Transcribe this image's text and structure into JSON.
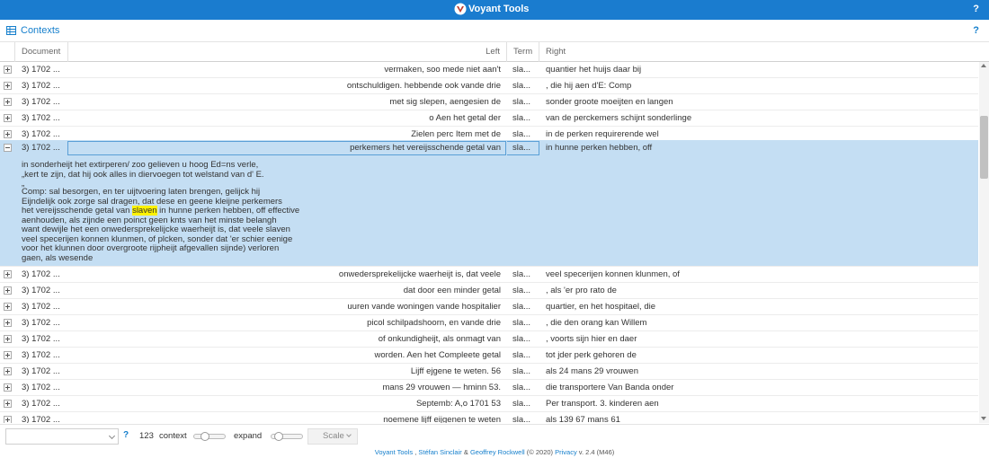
{
  "app": {
    "title": "Voyant Tools",
    "help": "?"
  },
  "panel": {
    "title": "Contexts",
    "help": "?"
  },
  "columns": {
    "document": "Document",
    "left": "Left",
    "term": "Term",
    "right": "Right"
  },
  "rows_before": [
    {
      "doc": "3) 1702 ...",
      "left": "vermaken, soo mede niet aan't",
      "term": "sla...",
      "right": "quantier het huijs daar bij"
    },
    {
      "doc": "3) 1702 ...",
      "left": "ontschuldigen. hebbende ook vande drie",
      "term": "sla...",
      "right": ", die hij aen d'E: Comp"
    },
    {
      "doc": "3) 1702 ...",
      "left": "met sig slepen, aengesien de",
      "term": "sla...",
      "right": "sonder groote moeijten en langen"
    },
    {
      "doc": "3) 1702 ...",
      "left": "o Aen het getal der",
      "term": "sla...",
      "right": "van de perckemers schijnt sonderlinge"
    },
    {
      "doc": "3) 1702 ...",
      "left": "Zielen perc Item met de",
      "term": "sla...",
      "right": "in de perken requirerende wel"
    }
  ],
  "selected_row": {
    "doc": "3) 1702 ...",
    "left": "perkemers het vereijsschende getal van",
    "term": "sla...",
    "right": "in hunne perken hebben, off"
  },
  "expanded": {
    "para1": "in sonderheijt het extirperen/ zoo gelieven u hoog Ed=ns verle,\n„kert te zijn, dat hij ook alles in diervoegen tot welstand van d' E.",
    "para2_top": "„",
    "para2_a": "Comp: sal besorgen, en ter uijtvoering laten brengen, gelijck hij\nEijndelijk ook zorge sal dragen, dat dese en geene kleijne perkemers\nhet vereijsschende getal van ",
    "keyword": "slaven",
    "para2_b": " in hunne perken hebben, off effective\naenhouden, als zijnde een poinct geen knts van het minste belangh\nwant dewijle het een onwedersprekelijcke waerheijt is, dat veele slaven\nveel specerijen konnen klunmen, of plcken, sonder dat 'er schier eenige\nvoor het klunnen door overgroote rijpheijt afgevallen sijnde) verloren\ngaen, als wesende"
  },
  "rows_after": [
    {
      "doc": "3) 1702 ...",
      "left": "onwedersprekelijcke waerheijt is, dat veele",
      "term": "sla...",
      "right": "veel specerijen konnen klunmen, of"
    },
    {
      "doc": "3) 1702 ...",
      "left": "dat door een minder getal",
      "term": "sla...",
      "right": ", als 'er pro rato de"
    },
    {
      "doc": "3) 1702 ...",
      "left": "uuren vande woningen vande hospitalier",
      "term": "sla...",
      "right": "quartier, en het hospitael, die"
    },
    {
      "doc": "3) 1702 ...",
      "left": "picol schilpadshoorn, en vande drie",
      "term": "sla...",
      "right": ", die den orang kan Willem"
    },
    {
      "doc": "3) 1702 ...",
      "left": "of onkundigheijt, als onmagt van",
      "term": "sla...",
      "right": ", voorts sijn hier en daer"
    },
    {
      "doc": "3) 1702 ...",
      "left": "worden. Aen het Compleete getal",
      "term": "sla...",
      "right": "tot jder perk gehoren de"
    },
    {
      "doc": "3) 1702 ...",
      "left": "Lijff ejgene te weten. 56",
      "term": "sla...",
      "right": "als 24 mans 29 vrouwen"
    },
    {
      "doc": "3) 1702 ...",
      "left": "mans 29 vrouwen — hminn 53.",
      "term": "sla...",
      "right": "die transportere Van Banda onder"
    },
    {
      "doc": "3) 1702 ...",
      "left": "Septemb: A,o 1701 53",
      "term": "sla...",
      "right": "Per transport. 3. kinderen aen"
    },
    {
      "doc": "3) 1702 ...",
      "left": "noemene lijff eijgenen te weten",
      "term": "sla...",
      "right": "als 139 67 mans 61"
    }
  ],
  "toolbar": {
    "help": "?",
    "count": "123",
    "context_label": "context",
    "expand_label": "expand",
    "scale_label": "Scale",
    "context_level": 0.25,
    "expand_level": 0.12
  },
  "footer": {
    "tools": "Voyant Tools",
    "sep1": " , ",
    "author1": "Stéfan Sinclair",
    "amp": " & ",
    "author2": "Geoffrey Rockwell",
    "year": " (© 2020) ",
    "privacy": "Privacy",
    "version": " v. 2.4 (M46)"
  },
  "colors": {
    "brand": "#1a7ccf",
    "selected": "#c4def3",
    "highlight": "#fff200",
    "link": "#157fcc"
  }
}
